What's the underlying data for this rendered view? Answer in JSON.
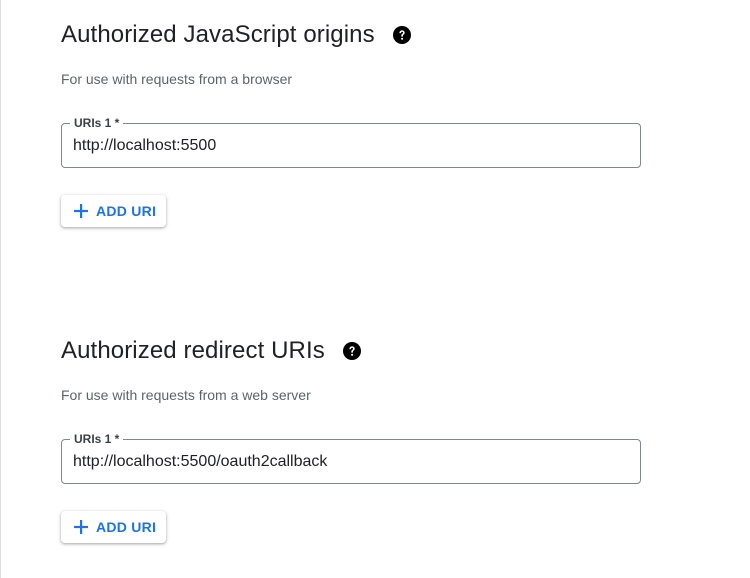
{
  "colors": {
    "accent": "#1a73e8",
    "text_primary": "#202124",
    "text_secondary": "#5f6368",
    "field_border": "#80868b"
  },
  "js_origins": {
    "title": "Authorized JavaScript origins",
    "help_icon": "help-circle-icon",
    "subtitle": "For use with requests from a browser",
    "uri_field": {
      "label": "URIs 1 *",
      "value": "http://localhost:5500"
    },
    "add_button": {
      "icon": "plus-icon",
      "label": "ADD URI"
    }
  },
  "redirect_uris": {
    "title": "Authorized redirect URIs",
    "help_icon": "help-circle-icon",
    "subtitle": "For use with requests from a web server",
    "uri_field": {
      "label": "URIs 1 *",
      "value": "http://localhost:5500/oauth2callback"
    },
    "add_button": {
      "icon": "plus-icon",
      "label": "ADD URI"
    }
  }
}
